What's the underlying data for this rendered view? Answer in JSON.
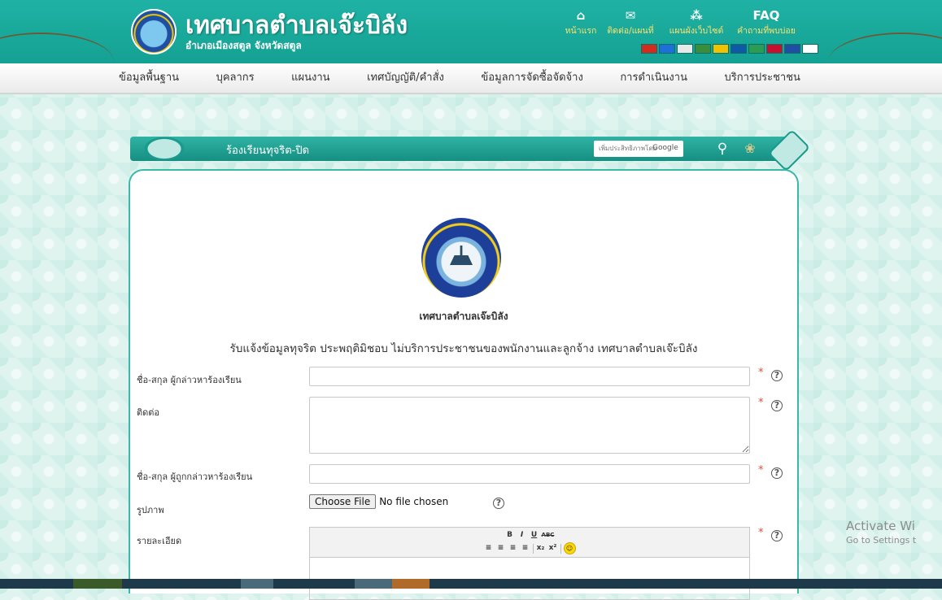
{
  "header": {
    "site_title": "เทศบาลตำบลเจ๊ะบิลัง",
    "site_subtitle": "อำเภอเมืองสตูล จังหวัดสตูล",
    "top_links": [
      {
        "icon": "home-icon",
        "glyph": "⌂",
        "label": "หน้าแรก"
      },
      {
        "icon": "envelope-icon",
        "glyph": "✉",
        "label": "ติดต่อ/แผนที่"
      },
      {
        "icon": "sitemap-icon",
        "glyph": "⁂",
        "label": "แผนผังเว็บไซต์"
      },
      {
        "icon": "faq-icon",
        "glyph": "FAQ",
        "label": "คำถามที่พบบ่อย"
      }
    ],
    "flag_colors": [
      "#d52b1e",
      "#1e6fd9",
      "#e9e9e9",
      "#3a8d3a",
      "#f2c200",
      "#0e5aa7",
      "#2b9c54",
      "#c8102e",
      "#1f4ea3",
      "#ffffff"
    ]
  },
  "menu": {
    "items": [
      "ข้อมูลพื้นฐาน",
      "บุคลากร",
      "แผนงาน",
      "เทศบัญญัติ/คำสั่ง",
      "ข้อมูลการจัดซื้อจัดจ้าง",
      "การดำเนินงาน",
      "บริการประชาชน"
    ]
  },
  "banner": {
    "title": "ร้องเรียนทุจริต-ปิด",
    "search_placeholder": "เพิ่มประสิทธิภาพโดย",
    "search_brand": "Google",
    "search_icon": "search-icon",
    "lotus_icon": "lotus-icon"
  },
  "form": {
    "org_name": "เทศบาลตำบลเจ๊ะบิลัง",
    "title": "รับแจ้งข้อมูลทุจริต ประพฤติมิชอบ ไม่บริการประชาชนของพนักงานและลูกจ้าง เทศบาลตำบลเจ๊ะบิลัง",
    "fields": {
      "complainant": {
        "label": "ชื่อ-สกุล ผู้กล่าวหาร้องเรียน",
        "value": "",
        "required": "*"
      },
      "contact": {
        "label": "ติดต่อ",
        "value": "",
        "required": "*"
      },
      "accused": {
        "label": "ชื่อ-สกุล ผู้ถูกกล่าวหาร้องเรียน",
        "value": "",
        "required": "*"
      },
      "photo": {
        "label": "รูปภาพ",
        "button": "Choose File",
        "status": "No file chosen"
      },
      "details": {
        "label": "รายละเอียด",
        "required": "*"
      }
    },
    "help_glyph": "?",
    "editor_toolbar": {
      "row1": [
        "B",
        "I",
        "U",
        "ABC"
      ],
      "row2": [
        "≡",
        "≡",
        "≡",
        "≡",
        "x₂",
        "x²",
        "☺"
      ]
    }
  },
  "watermark": {
    "line1": "Activate Wi",
    "line2": "Go to Settings t"
  }
}
